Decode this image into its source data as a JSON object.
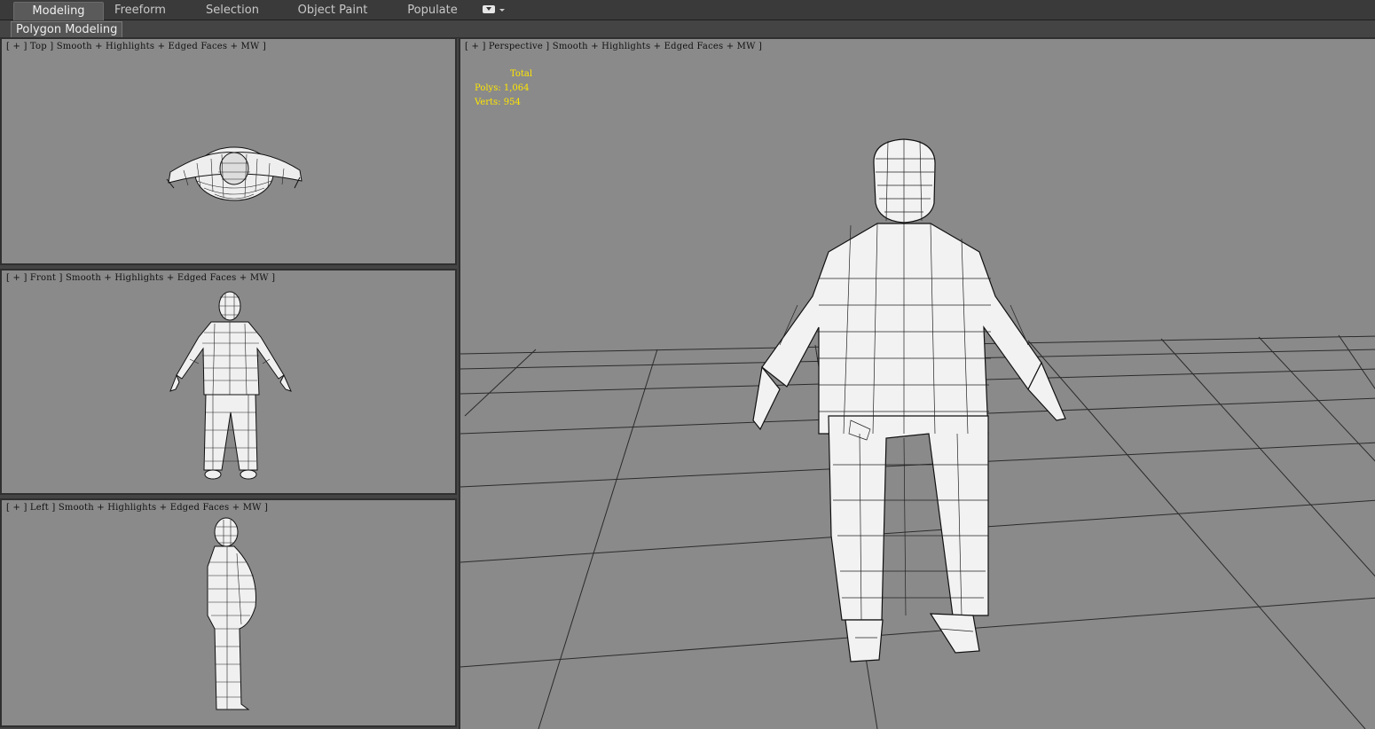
{
  "ribbon": {
    "tabs": [
      {
        "label": "Modeling",
        "active": true
      },
      {
        "label": "Freeform",
        "active": false
      },
      {
        "label": "Selection",
        "active": false
      },
      {
        "label": "Object Paint",
        "active": false
      },
      {
        "label": "Populate",
        "active": false
      }
    ],
    "options_icon": "dropdown-icon"
  },
  "subribbon": {
    "panel_label": "Polygon Modeling"
  },
  "viewports": {
    "top": {
      "label": "[ + ] Top ] Smooth + Highlights + Edged Faces + MW ]"
    },
    "front": {
      "label": "[ + ] Front ] Smooth + Highlights + Edged Faces + MW ]"
    },
    "left": {
      "label": "[ + ] Left ] Smooth + Highlights + Edged Faces + MW ]"
    },
    "perspective": {
      "label": "[ + ] Perspective ] Smooth + Highlights + Edged Faces + MW ]"
    }
  },
  "stats": {
    "header": "Total",
    "polys_label": "Polys:",
    "polys_value": "1,064",
    "verts_label": "Verts:",
    "verts_value": "954"
  },
  "colors": {
    "viewport_bg": "#8a8a8a",
    "stats_text": "#ffe600",
    "ui_dark": "#3a3a3a"
  }
}
